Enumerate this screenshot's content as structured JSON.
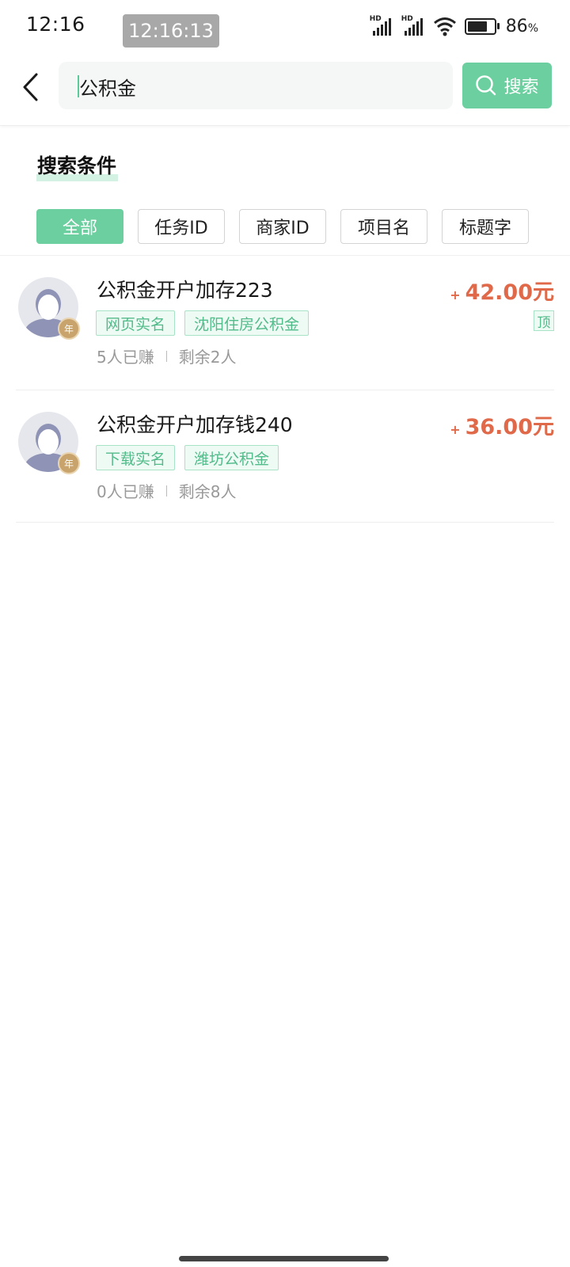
{
  "status_bar": {
    "time": "12:16",
    "clock_overlay": "12:16:13",
    "signal_label_1": "HD",
    "signal_label_2": "HD",
    "battery_percent": "86",
    "battery_unit": "%",
    "battery_level": 0.86
  },
  "search": {
    "query": "公积金",
    "button_label": "搜索"
  },
  "filters": {
    "title": "搜索条件",
    "chips": [
      "全部",
      "任务ID",
      "商家ID",
      "项目名",
      "标题字"
    ],
    "active_index": 0
  },
  "tasks": [
    {
      "title": "公积金开户加存223",
      "tags": [
        "网页实名",
        "沈阳住房公积金"
      ],
      "earned": "5人已赚",
      "remaining": "剩余2人",
      "price_prefix": "+",
      "price": "42.00元",
      "top_label": "顶",
      "badge_label": "年"
    },
    {
      "title": "公积金开户加存钱240",
      "tags": [
        "下载实名",
        "潍坊公积金"
      ],
      "earned": "0人已赚",
      "remaining": "剩余8人",
      "price_prefix": "+",
      "price": "36.00元",
      "badge_label": "年"
    }
  ],
  "colors": {
    "accent_green": "#6ccf9f",
    "tag_green": "#52bb8a",
    "price_red": "#e0694a"
  },
  "icons": {
    "back": "chevron-left-icon",
    "search": "search-icon",
    "avatar": "default-avatar-icon",
    "wifi": "wifi-icon",
    "battery": "battery-icon",
    "signal": "signal-icon"
  }
}
